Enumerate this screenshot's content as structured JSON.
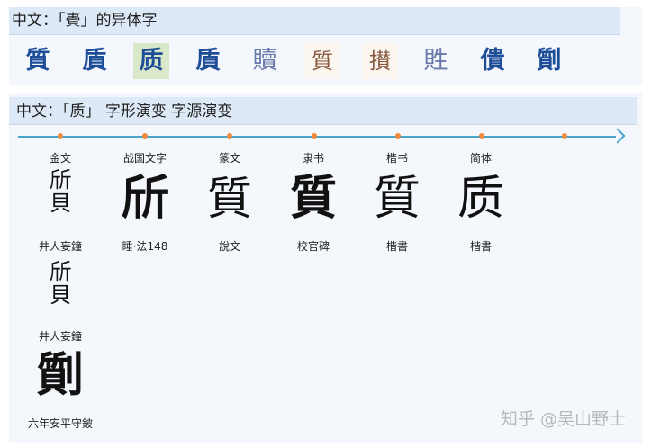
{
  "section1": {
    "header_prefix": "中文：",
    "header_char": "「䝴」",
    "header_suffix": "的异体字",
    "variants": [
      "質",
      "貭",
      "质",
      "貭",
      "贖",
      "質",
      "攅",
      "貹",
      "僓",
      "劕"
    ]
  },
  "section2": {
    "header": "中文：「质」 字形演变 字源演变",
    "eras": [
      "金文",
      "战国文字",
      "篆文",
      "隶书",
      "楷书",
      "简体"
    ],
    "columns": [
      {
        "glyph": "斦貝",
        "source": "井人妄鐘"
      },
      {
        "glyph": "斦",
        "source": "睡·法148"
      },
      {
        "glyph": "質",
        "source": "說文"
      },
      {
        "glyph": "質",
        "source": "校官碑"
      },
      {
        "glyph": "質",
        "source": "楷書"
      },
      {
        "glyph": "质",
        "source": "楷書"
      }
    ],
    "extra": [
      {
        "glyph": "斦貝",
        "source": "井人妄鐘"
      },
      {
        "glyph": "劕",
        "source": "六年安平守鈹"
      }
    ]
  },
  "watermark": "知乎 @吴山野士"
}
